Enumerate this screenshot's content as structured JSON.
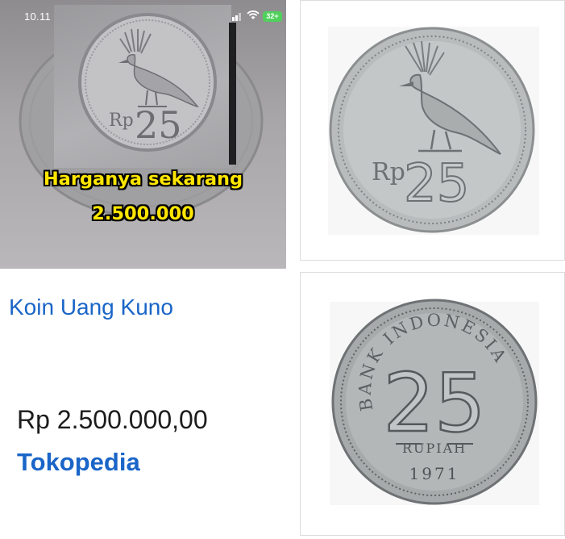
{
  "status_bar": {
    "time": "10.11",
    "battery": "32+"
  },
  "left_image": {
    "coin_text": "Rp25",
    "caption_line1": "Harganya sekarang",
    "caption_line2": "2.500.000"
  },
  "result": {
    "title": "Koin Uang Kuno",
    "price": "Rp 2.500.000,00",
    "source": "Tokopedia"
  },
  "coin_front": {
    "rp": "Rp",
    "value": "25"
  },
  "coin_back": {
    "arc_text": "BANK INDONESIA",
    "value": "25",
    "unit": "RUPIAH",
    "year": "1971"
  },
  "colors": {
    "link": "#1a65c8",
    "caption": "#ffe600",
    "coin_silver": "#b9bcbd"
  }
}
